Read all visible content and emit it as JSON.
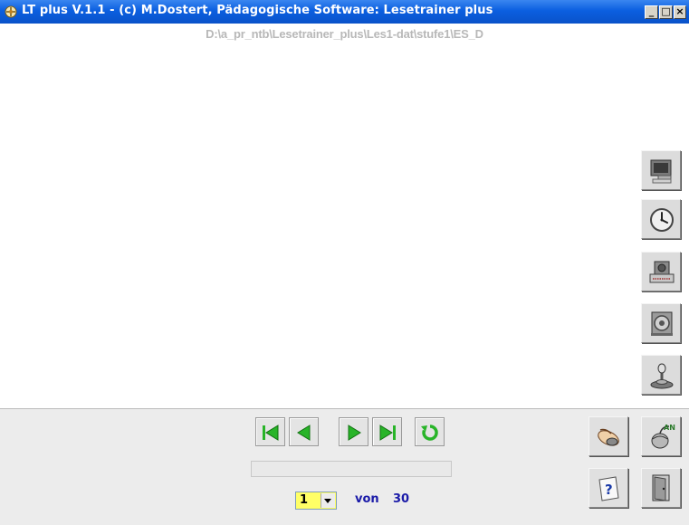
{
  "window": {
    "title": "LT plus   V.1.1 - (c) M.Dostert, Pädagogische Software: Lesetrainer plus",
    "minimize": "_",
    "maximize": "□",
    "close": "×"
  },
  "path": "D:\\a_pr_ntb\\Lesetrainer_plus\\Les1-dat\\stufe1\\ES_D",
  "side_tools": [
    {
      "icon": "computer-terminal-icon"
    },
    {
      "icon": "clock-icon"
    },
    {
      "icon": "printer-icon"
    },
    {
      "icon": "speaker-icon"
    },
    {
      "icon": "joystick-icon"
    }
  ],
  "navigation": {
    "buttons": [
      "first-icon",
      "previous-icon",
      "next-icon",
      "last-icon",
      "repeat-icon"
    ]
  },
  "pager": {
    "current": "1",
    "of_label": "von",
    "total": "30"
  },
  "bottom_right_buttons": [
    {
      "icon": "hand-mouse-icon"
    },
    {
      "icon": "mouse-an-icon",
      "text": "AN"
    },
    {
      "icon": "help-icon",
      "text": "?"
    },
    {
      "icon": "exit-door-icon"
    }
  ],
  "colors": {
    "titlebar": "#0b5fe0",
    "nav_green": "#28b428",
    "pager_text": "#1a1aa8",
    "select_bg": "#ffff66"
  }
}
